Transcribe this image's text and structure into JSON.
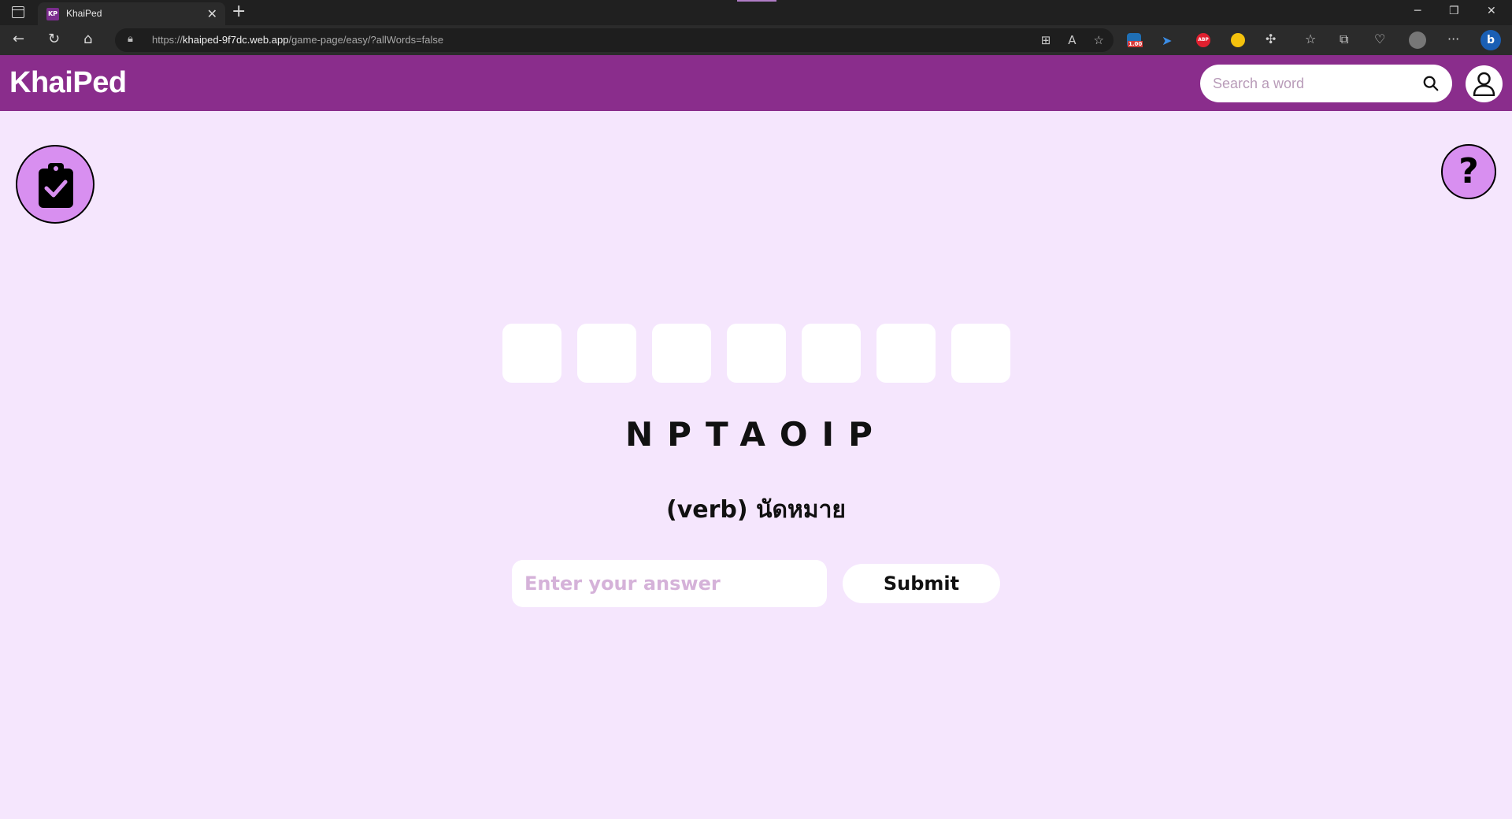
{
  "browser": {
    "tab_title": "KhaiPed",
    "tab_favicon_text": "KP",
    "url_host": "khaiped-9f7dc.web.app",
    "url_prefix": "https://",
    "url_path": "/game-page/easy/?allWords=false",
    "extension_badge": "1.00"
  },
  "header": {
    "logo": "KhaiPed",
    "search_placeholder": "Search a word"
  },
  "game": {
    "tile_count": 7,
    "scrambled_letters": "NPTAOIP",
    "hint": "(verb) นัดหมาย",
    "answer_placeholder": "Enter your answer",
    "submit_label": "Submit",
    "help_symbol": "?"
  },
  "colors": {
    "header_purple": "#8a2d8c",
    "page_background": "#f5e6fd",
    "button_violet": "#d88ff0"
  }
}
